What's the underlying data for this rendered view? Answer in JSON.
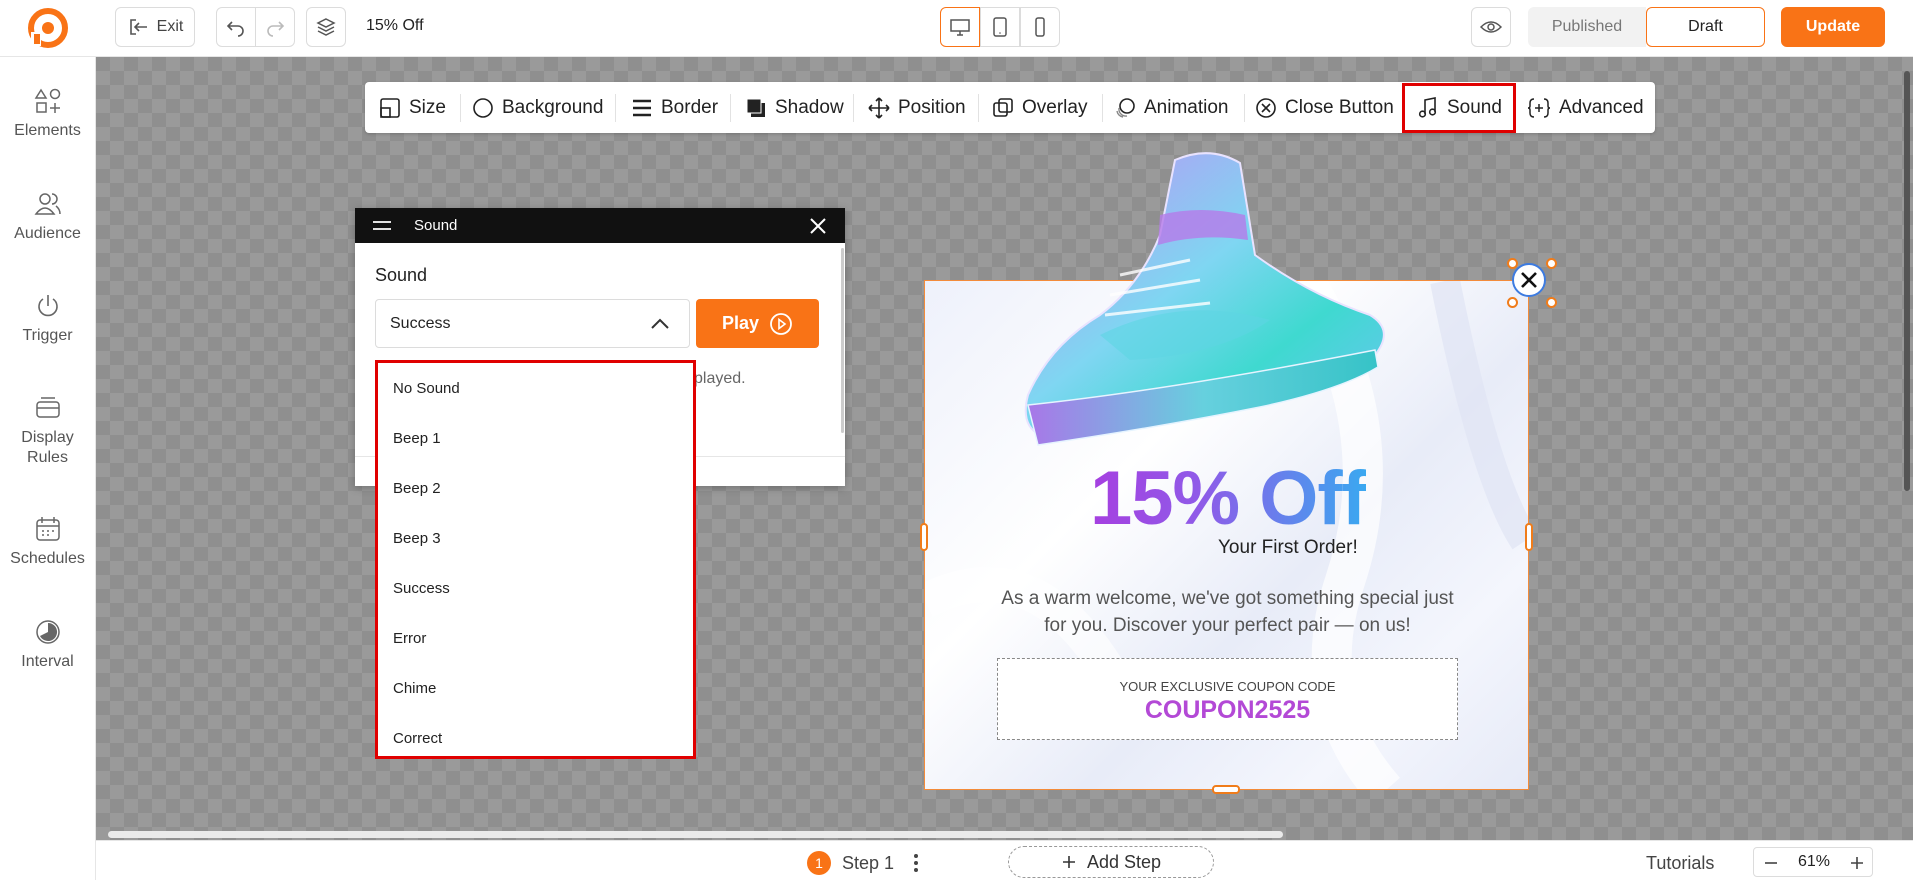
{
  "header": {
    "exit_label": "Exit",
    "campaign_name": "15% Off",
    "published_label": "Published",
    "draft_label": "Draft",
    "update_label": "Update"
  },
  "sidebar": {
    "items": [
      {
        "label": "Elements"
      },
      {
        "label": "Audience"
      },
      {
        "label": "Trigger"
      },
      {
        "label": "Display Rules"
      },
      {
        "label": "Schedules"
      },
      {
        "label": "Interval"
      }
    ]
  },
  "toolbar": {
    "items": [
      {
        "label": "Size"
      },
      {
        "label": "Background"
      },
      {
        "label": "Border"
      },
      {
        "label": "Shadow"
      },
      {
        "label": "Position"
      },
      {
        "label": "Overlay"
      },
      {
        "label": "Animation"
      },
      {
        "label": "Close Button"
      },
      {
        "label": "Sound"
      },
      {
        "label": "Advanced"
      }
    ]
  },
  "sound_panel": {
    "title": "Sound",
    "field_label": "Sound",
    "selected": "Success",
    "play_label": "Play",
    "hint_fragment": "played.",
    "options": [
      "No Sound",
      "Beep 1",
      "Beep 2",
      "Beep 3",
      "Success",
      "Error",
      "Chime",
      "Correct"
    ]
  },
  "popup": {
    "headline": "15% Off",
    "subheadline": "Your First Order!",
    "body": "As a warm welcome, we've got something special just for you. Discover your perfect pair — on us!",
    "coupon_label": "YOUR EXCLUSIVE COUPON CODE",
    "coupon_code": "COUPON2525"
  },
  "footer": {
    "step_number": "1",
    "step_label": "Step 1",
    "add_step_label": "Add Step",
    "tutorials_label": "Tutorials",
    "zoom_value": "61%"
  },
  "colors": {
    "accent": "#f97316",
    "highlight_red": "#e00000",
    "headline_purple": "#a63fe0",
    "headline_blue": "#3aa8f0",
    "coupon_purple": "#b349d6"
  }
}
